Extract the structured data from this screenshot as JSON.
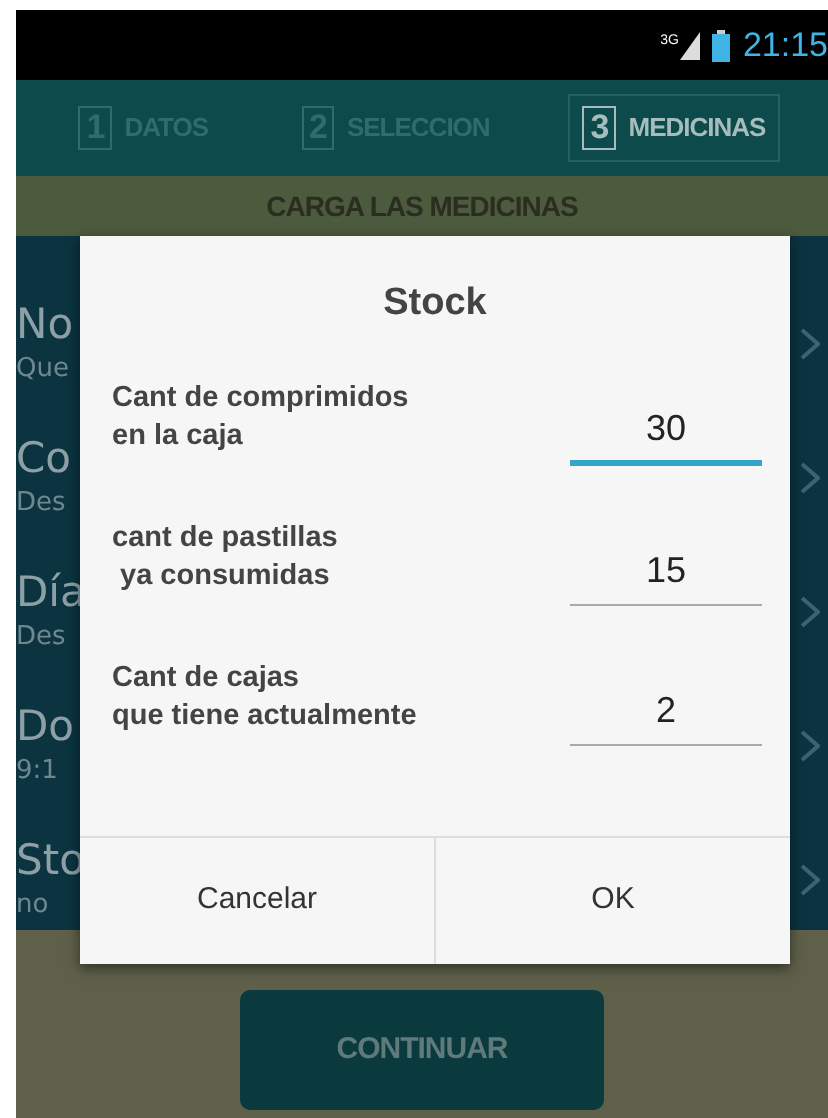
{
  "status_bar": {
    "network_type": "3G",
    "time": "21:15"
  },
  "tabs": [
    {
      "number": "1",
      "label": "DATOS",
      "selected": false
    },
    {
      "number": "2",
      "label": "SELECCION",
      "selected": false
    },
    {
      "number": "3",
      "label": "MEDICINAS",
      "selected": true
    }
  ],
  "section_title": "CARGA LAS MEDICINAS",
  "list_items": [
    {
      "title": "No",
      "subtitle": "Que"
    },
    {
      "title": "Co",
      "subtitle": "Des"
    },
    {
      "title": "Día",
      "subtitle": "Des"
    },
    {
      "title": "Do",
      "subtitle": "9:1"
    },
    {
      "title": "Sto",
      "subtitle": "no"
    }
  ],
  "dialog": {
    "title": "Stock",
    "fields": [
      {
        "label": "Cant de comprimidos\nen la caja",
        "value": "30",
        "focused": true
      },
      {
        "label": "cant de pastillas\n ya consumidas",
        "value": "15",
        "focused": false
      },
      {
        "label": "Cant de cajas\nque tiene actualmente",
        "value": "2",
        "focused": false
      }
    ],
    "buttons": [
      "Cancelar",
      "OK"
    ]
  },
  "continue_button": "CONTINUAR"
}
